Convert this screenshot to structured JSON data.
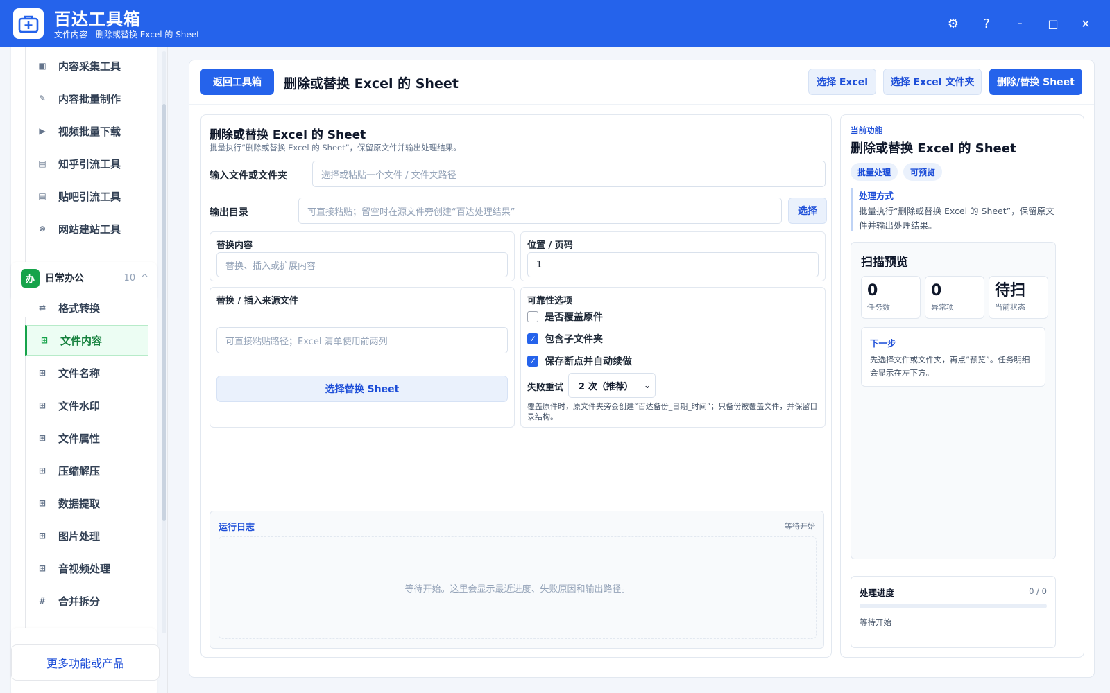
{
  "app": {
    "title": "百达工具箱",
    "subtitle": "文件内容 - 删除或替换 Excel 的 Sheet"
  },
  "window": {
    "settings": "⚙",
    "help": "?",
    "minimize": "–",
    "maximize": "□",
    "close": "✕"
  },
  "sidebar": {
    "group1_items": [
      {
        "label": "内容采集工具",
        "icon": "▣"
      },
      {
        "label": "内容批量制作",
        "icon": "✎"
      },
      {
        "label": "视频批量下载",
        "icon": "▶"
      },
      {
        "label": "知乎引流工具",
        "icon": "▤"
      },
      {
        "label": "贴吧引流工具",
        "icon": "▤"
      },
      {
        "label": "网站建站工具",
        "icon": "⊗"
      }
    ],
    "group2": {
      "badge": "办",
      "title": "日常办公",
      "count": "10",
      "chevron": "^"
    },
    "group2_items": [
      {
        "label": "格式转换",
        "icon": "⇄"
      },
      {
        "label": "文件内容",
        "icon": "⊞"
      },
      {
        "label": "文件名称",
        "icon": "⊞"
      },
      {
        "label": "文件水印",
        "icon": "⊞"
      },
      {
        "label": "文件属性",
        "icon": "⊞"
      },
      {
        "label": "压缩解压",
        "icon": "⊞"
      },
      {
        "label": "数据提取",
        "icon": "⊞"
      },
      {
        "label": "图片处理",
        "icon": "⊞"
      },
      {
        "label": "音视频处理",
        "icon": "⊞"
      },
      {
        "label": "合并拆分",
        "icon": "#"
      }
    ],
    "more": "更多功能或产品"
  },
  "header": {
    "back": "返回工具箱",
    "title": "删除或替换 Excel 的 Sheet",
    "select_excel": "选择 Excel",
    "select_folder": "选择 Excel 文件夹",
    "run": "删除/替换 Sheet"
  },
  "form": {
    "title": "删除或替换 Excel 的 Sheet",
    "desc": "批量执行“删除或替换 Excel 的 Sheet”，保留原文件并输出处理结果。",
    "input_label": "输入文件或文件夹",
    "input_placeholder": "选择或粘贴一个文件 / 文件夹路径",
    "output_label": "输出目录",
    "output_placeholder": "可直接粘贴；留空时在源文件旁创建“百达处理结果”",
    "output_btn": "选择",
    "replace_label": "替换内容",
    "replace_placeholder": "替换、插入或扩展内容",
    "pos_label": "位置 / 页码",
    "pos_value": "1",
    "source_label": "替换 / 插入来源文件",
    "source_placeholder": "可直接粘贴路径；Excel 清单使用前两列",
    "source_btn": "选择替换 Sheet",
    "reliab_label": "可靠性选项",
    "opt1": "是否覆盖原件",
    "opt2": "包含子文件夹",
    "opt3": "保存断点并自动续做",
    "retry_label": "失败重试",
    "retry_value": "2 次（推荐）",
    "note": "覆盖原件时，原文件夹旁会创建“百达备份_日期_时间”；只备份被覆盖文件，并保留目录结构。"
  },
  "log": {
    "title": "运行日志",
    "status": "等待开始",
    "empty": "等待开始。这里会显示最近进度、失败原因和输出路径。"
  },
  "info": {
    "current_label": "当前功能",
    "current_title": "删除或替换 Excel 的 Sheet",
    "tags": [
      "批量处理",
      "可预览"
    ],
    "method_title": "处理方式",
    "method_desc": "批量执行“删除或替换 Excel 的 Sheet”，保留原文件并输出处理结果。",
    "scan_title": "扫描预览",
    "stats": [
      {
        "value": "0",
        "label": "任务数"
      },
      {
        "value": "0",
        "label": "异常项"
      },
      {
        "value": "待扫",
        "label": "当前状态"
      }
    ],
    "next_title": "下一步",
    "next_desc": "先选择文件或文件夹，再点“预览”。任务明细会显示在左下方。",
    "progress_title": "处理进度",
    "progress_count": "0 / 0",
    "progress_fraction": 0,
    "progress_status": "等待开始"
  }
}
